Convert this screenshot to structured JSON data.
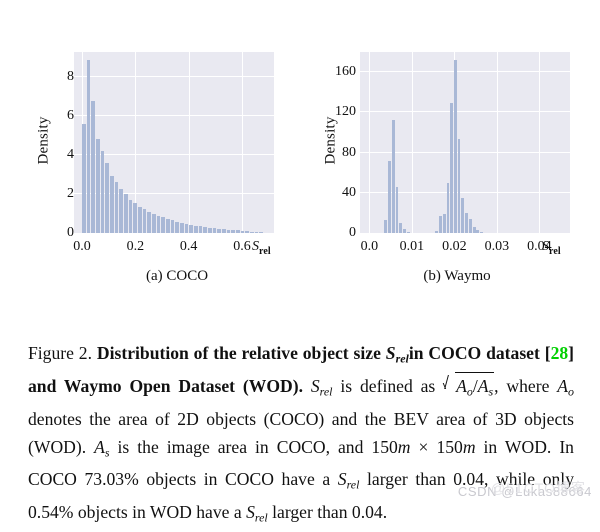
{
  "figure": {
    "panels": [
      {
        "id": "coco",
        "subcaption": "(a) COCO",
        "ylabel": "Density",
        "axis_name_symbol": "S",
        "axis_name_subscript": "rel"
      },
      {
        "id": "waymo",
        "subcaption": "(b) Waymo",
        "ylabel": "Density",
        "axis_name_symbol": "S",
        "axis_name_subscript": "rel"
      }
    ]
  },
  "caption": {
    "figure_number": "Figure 2.",
    "bold_lead": "Distribution of the relative object size",
    "sym_srel": "S",
    "sub_rel": "rel",
    "bold_mid_1": "in COCO dataset [",
    "citation": "28",
    "bold_mid_2": "] and Waymo Open Dataset (WOD).",
    "text_1": "is defined as",
    "sqrt_num": "A",
    "sqrt_num_sub": "o",
    "sqrt_den": "A",
    "sqrt_den_sub": "s",
    "text_2": ", where",
    "sym_ao": "A",
    "sub_o": "o",
    "text_3": "denotes the area of 2D objects (COCO) and the BEV area of 3D objects (WOD).",
    "sym_as": "A",
    "sub_s": "s",
    "text_4": "is the image area in COCO, and",
    "num_150m_1": "150",
    "unit_m_1": "m",
    "times": "×",
    "num_150m_2": "150",
    "unit_m_2": "m",
    "text_5": "in WOD. In COCO 73.03% objects in COCO have a",
    "text_6": "larger than 0.04, while only 0.54% objects in WOD have a",
    "text_7": "larger than 0.04."
  },
  "watermark": {
    "text": "CSDN @Lukas88664",
    "underlay": "@51CTO博客"
  },
  "colors": {
    "plot_background": "#e9e9f1",
    "bar": "#a9b8d6",
    "gridline": "#ffffff",
    "page_background": "#ffffff",
    "citation_green": "#00d000",
    "watermark_gray": "#c9c9cf"
  },
  "chart_data": [
    {
      "type": "bar",
      "id": "coco",
      "title": "(a) COCO",
      "xlabel": "S_rel",
      "ylabel": "Density",
      "xlim": [
        -0.03,
        0.72
      ],
      "ylim": [
        0,
        9.3
      ],
      "xticks": [
        0.0,
        0.2,
        0.4,
        0.6
      ],
      "xtick_labels": [
        "0.0",
        "0.2",
        "0.4",
        "0.6"
      ],
      "yticks": [
        0,
        2,
        4,
        6,
        8
      ],
      "ytick_labels": [
        "0",
        "2",
        "4",
        "6",
        "8"
      ],
      "grid": true,
      "bin_width": 0.0175,
      "x": [
        0.0088,
        0.0262,
        0.0437,
        0.0613,
        0.0788,
        0.0962,
        0.1138,
        0.1313,
        0.1487,
        0.1663,
        0.1838,
        0.2012,
        0.2188,
        0.2363,
        0.2537,
        0.2713,
        0.2888,
        0.3062,
        0.3238,
        0.3413,
        0.3587,
        0.3763,
        0.3938,
        0.4112,
        0.4288,
        0.4463,
        0.4637,
        0.4813,
        0.4988,
        0.5162,
        0.5338,
        0.5513,
        0.5687,
        0.5863,
        0.6038,
        0.6212,
        0.6388,
        0.6563,
        0.6737
      ],
      "values": [
        5.6,
        8.9,
        6.8,
        4.85,
        4.2,
        3.6,
        2.95,
        2.6,
        2.25,
        2.0,
        1.72,
        1.52,
        1.35,
        1.22,
        1.08,
        0.98,
        0.88,
        0.8,
        0.72,
        0.65,
        0.58,
        0.52,
        0.47,
        0.42,
        0.38,
        0.34,
        0.3,
        0.27,
        0.24,
        0.21,
        0.19,
        0.17,
        0.15,
        0.13,
        0.11,
        0.09,
        0.07,
        0.05,
        0.03
      ]
    },
    {
      "type": "bar",
      "id": "waymo",
      "title": "(b) Waymo",
      "xlabel": "S_rel",
      "ylabel": "Density",
      "xlim": [
        -0.0022,
        0.0472
      ],
      "ylim": [
        0,
        180
      ],
      "xticks": [
        0.0,
        0.01,
        0.02,
        0.03,
        0.04
      ],
      "xtick_labels": [
        "0.0",
        "0.01",
        "0.02",
        "0.03",
        "0.04"
      ],
      "yticks": [
        0,
        40,
        80,
        120,
        160
      ],
      "ytick_labels": [
        "0",
        "40",
        "80",
        "120",
        "160"
      ],
      "grid": true,
      "bin_width": 0.00088,
      "x": [
        0.004,
        0.0049,
        0.0058,
        0.0066,
        0.0075,
        0.0084,
        0.0093,
        0.016,
        0.0168,
        0.0177,
        0.0186,
        0.0195,
        0.0204,
        0.0212,
        0.0221,
        0.023,
        0.0239,
        0.0248,
        0.0256,
        0.0265,
        0.0274
      ],
      "values": [
        13,
        72,
        112,
        46,
        10,
        4,
        1,
        2,
        17,
        19,
        50,
        129,
        172,
        93,
        35,
        20,
        14,
        6,
        3,
        1,
        0.5
      ]
    }
  ]
}
